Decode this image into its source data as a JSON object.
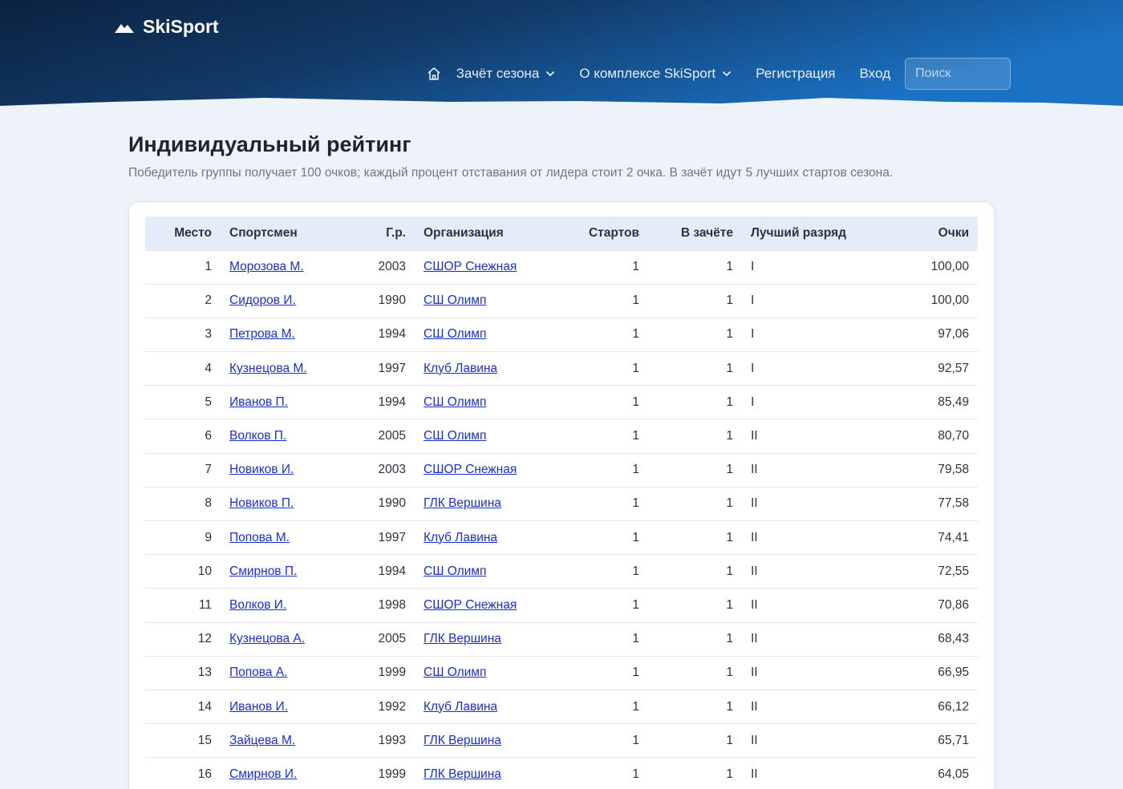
{
  "brand": {
    "name": "SkiSport"
  },
  "nav": {
    "items": [
      {
        "label": "Зачёт сезона",
        "dropdown": true
      },
      {
        "label": "О комплексе SkiSport",
        "dropdown": true
      },
      {
        "label": "Регистрация",
        "dropdown": false
      },
      {
        "label": "Вход",
        "dropdown": false
      }
    ],
    "search_placeholder": "Поиск"
  },
  "page": {
    "title": "Индивидуальный рейтинг",
    "subtitle": "Победитель группы получает 100 очков; каждый процент отставания от лидера стоит 2 очка. В зачёт идут 5 лучших стартов сезона."
  },
  "table": {
    "columns": [
      "Место",
      "Спортсмен",
      "Г.р.",
      "Организация",
      "Стартов",
      "В зачёте",
      "Лучший разряд",
      "Очки"
    ],
    "rows": [
      {
        "place": "1",
        "athlete": "Морозова М.",
        "year": "2003",
        "org": "СШОР Снежная",
        "starts": "1",
        "counted": "1",
        "rank": "I",
        "points": "100,00"
      },
      {
        "place": "2",
        "athlete": "Сидоров И.",
        "year": "1990",
        "org": "СШ Олимп",
        "starts": "1",
        "counted": "1",
        "rank": "I",
        "points": "100,00"
      },
      {
        "place": "3",
        "athlete": "Петрова М.",
        "year": "1994",
        "org": "СШ Олимп",
        "starts": "1",
        "counted": "1",
        "rank": "I",
        "points": "97,06"
      },
      {
        "place": "4",
        "athlete": "Кузнецова М.",
        "year": "1997",
        "org": "Клуб Лавина",
        "starts": "1",
        "counted": "1",
        "rank": "I",
        "points": "92,57"
      },
      {
        "place": "5",
        "athlete": "Иванов П.",
        "year": "1994",
        "org": "СШ Олимп",
        "starts": "1",
        "counted": "1",
        "rank": "I",
        "points": "85,49"
      },
      {
        "place": "6",
        "athlete": "Волков П.",
        "year": "2005",
        "org": "СШ Олимп",
        "starts": "1",
        "counted": "1",
        "rank": "II",
        "points": "80,70"
      },
      {
        "place": "7",
        "athlete": "Новиков И.",
        "year": "2003",
        "org": "СШОР Снежная",
        "starts": "1",
        "counted": "1",
        "rank": "II",
        "points": "79,58"
      },
      {
        "place": "8",
        "athlete": "Новиков П.",
        "year": "1990",
        "org": "ГЛК Вершина",
        "starts": "1",
        "counted": "1",
        "rank": "II",
        "points": "77,58"
      },
      {
        "place": "9",
        "athlete": "Попова М.",
        "year": "1997",
        "org": "Клуб Лавина",
        "starts": "1",
        "counted": "1",
        "rank": "II",
        "points": "74,41"
      },
      {
        "place": "10",
        "athlete": "Смирнов П.",
        "year": "1994",
        "org": "СШ Олимп",
        "starts": "1",
        "counted": "1",
        "rank": "II",
        "points": "72,55"
      },
      {
        "place": "11",
        "athlete": "Волков И.",
        "year": "1998",
        "org": "СШОР Снежная",
        "starts": "1",
        "counted": "1",
        "rank": "II",
        "points": "70,86"
      },
      {
        "place": "12",
        "athlete": "Кузнецова А.",
        "year": "2005",
        "org": "ГЛК Вершина",
        "starts": "1",
        "counted": "1",
        "rank": "II",
        "points": "68,43"
      },
      {
        "place": "13",
        "athlete": "Попова А.",
        "year": "1999",
        "org": "СШ Олимп",
        "starts": "1",
        "counted": "1",
        "rank": "II",
        "points": "66,95"
      },
      {
        "place": "14",
        "athlete": "Иванов И.",
        "year": "1992",
        "org": "Клуб Лавина",
        "starts": "1",
        "counted": "1",
        "rank": "II",
        "points": "66,12"
      },
      {
        "place": "15",
        "athlete": "Зайцева М.",
        "year": "1993",
        "org": "ГЛК Вершина",
        "starts": "1",
        "counted": "1",
        "rank": "II",
        "points": "65,71"
      },
      {
        "place": "16",
        "athlete": "Смирнов И.",
        "year": "1999",
        "org": "ГЛК Вершина",
        "starts": "1",
        "counted": "1",
        "rank": "II",
        "points": "64,05"
      }
    ]
  },
  "icons": {
    "logo": "mountain-icon",
    "home": "home-icon",
    "dropdown": "chevron-down-icon"
  },
  "colors": {
    "header_dark": "#0d2745",
    "header_light": "#1a6fc0",
    "link": "#1a2fd0",
    "page_bg": "#eef3fa",
    "table_head_bg": "#e3ecf8"
  }
}
